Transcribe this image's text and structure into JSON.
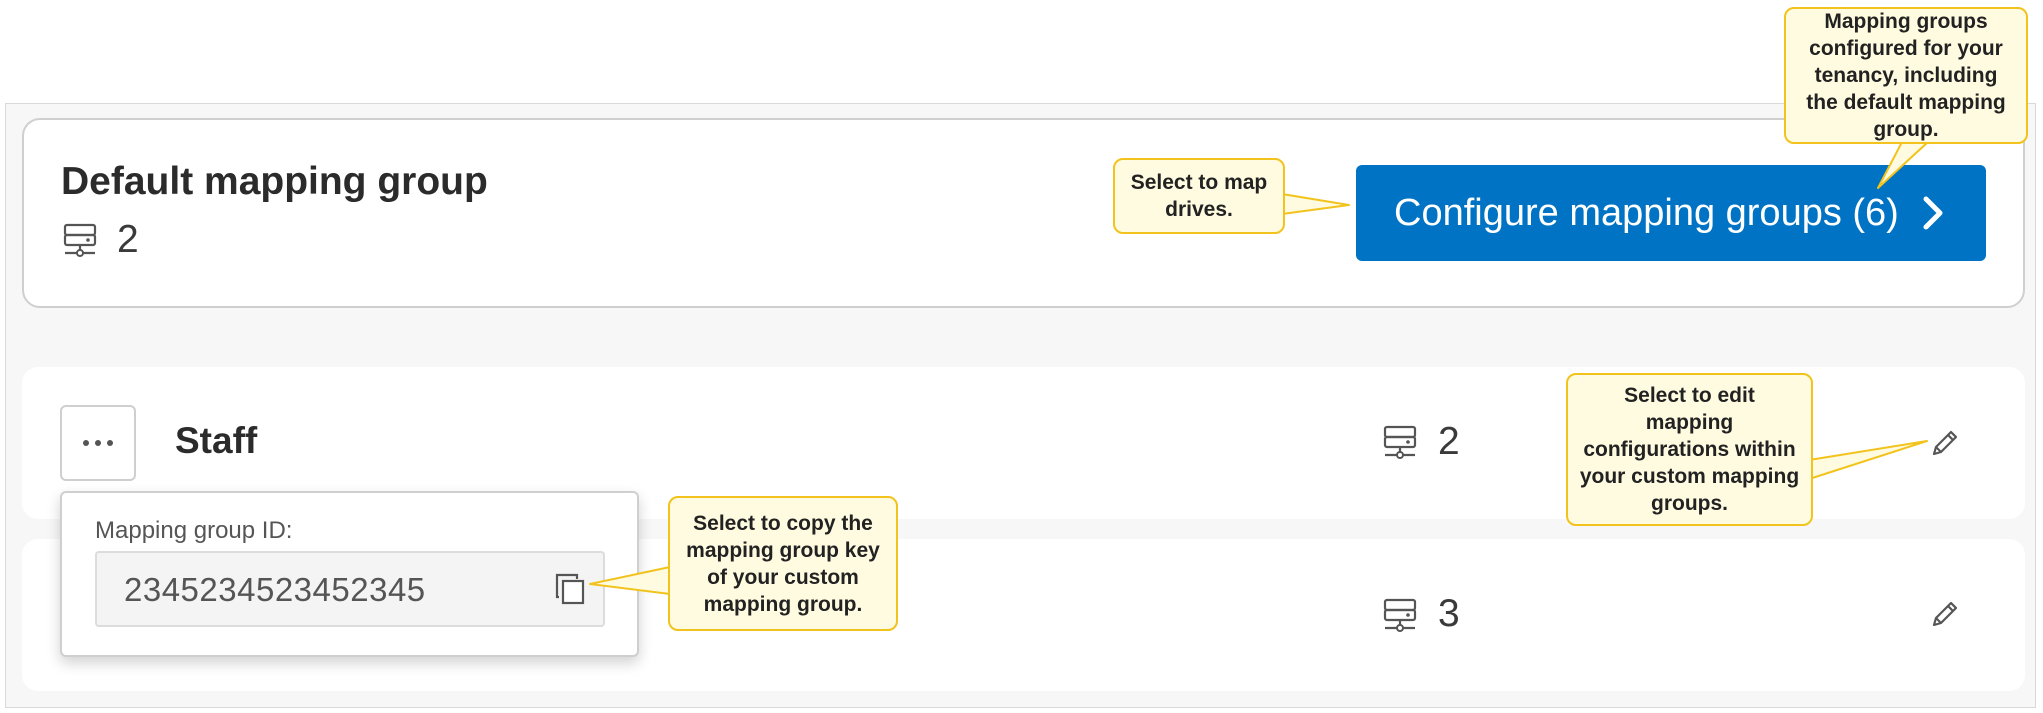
{
  "default_group": {
    "title": "Default mapping group",
    "drive_count": "2",
    "configure_button_label": "Configure mapping groups (6)"
  },
  "groups": [
    {
      "name": "Staff",
      "drive_count": "2"
    },
    {
      "name": "",
      "drive_count": "3"
    }
  ],
  "popover": {
    "label": "Mapping group ID:",
    "value": "2345234523452345"
  },
  "callouts": {
    "map_drives": "Select to map drives.",
    "mapping_groups": "Mapping groups configured for your tenancy, including the default mapping group.",
    "edit_mapping": "Select to edit mapping configurations within your custom mapping groups.",
    "copy_key": "Select to copy the mapping group key of your custom mapping group."
  },
  "icons": {
    "drive": "network-drive-icon",
    "chevron": "chevron-right-icon",
    "pencil": "pencil-icon",
    "copy": "copy-icon",
    "more": "more-horizontal-icon"
  },
  "colors": {
    "primary_button": "#0073c4",
    "callout_fill": "#fffbe0",
    "callout_border": "#f2c31c"
  }
}
